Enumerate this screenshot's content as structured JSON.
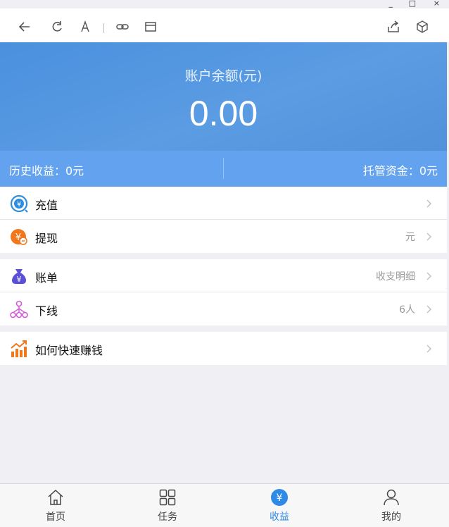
{
  "window": {
    "min": "_",
    "max": "□",
    "close": "×"
  },
  "balance": {
    "label": "账户余额(元)",
    "amount": "0.00",
    "history": "历史收益：0元",
    "custody": "托管资金：0元"
  },
  "menu_group1": [
    {
      "label": "充值",
      "value": "",
      "icon": "recharge-icon"
    },
    {
      "label": "提现",
      "value": "元",
      "icon": "withdraw-icon"
    }
  ],
  "menu_group2": [
    {
      "label": "账单",
      "value": "收支明细",
      "icon": "moneybag-icon"
    },
    {
      "label": "下线",
      "value": "6人",
      "icon": "network-icon"
    }
  ],
  "menu_group3": [
    {
      "label": "如何快速赚钱",
      "value": "",
      "icon": "chart-up-icon"
    }
  ],
  "tabs": [
    {
      "label": "首页",
      "icon": "home-icon"
    },
    {
      "label": "任务",
      "icon": "grid-icon"
    },
    {
      "label": "收益",
      "icon": "yen-icon",
      "active": true
    },
    {
      "label": "我的",
      "icon": "user-icon"
    }
  ],
  "colors": {
    "header": "#4a90de",
    "strip": "#62a2ee",
    "accent": "#2f8ae6",
    "background": "#efeff4"
  }
}
